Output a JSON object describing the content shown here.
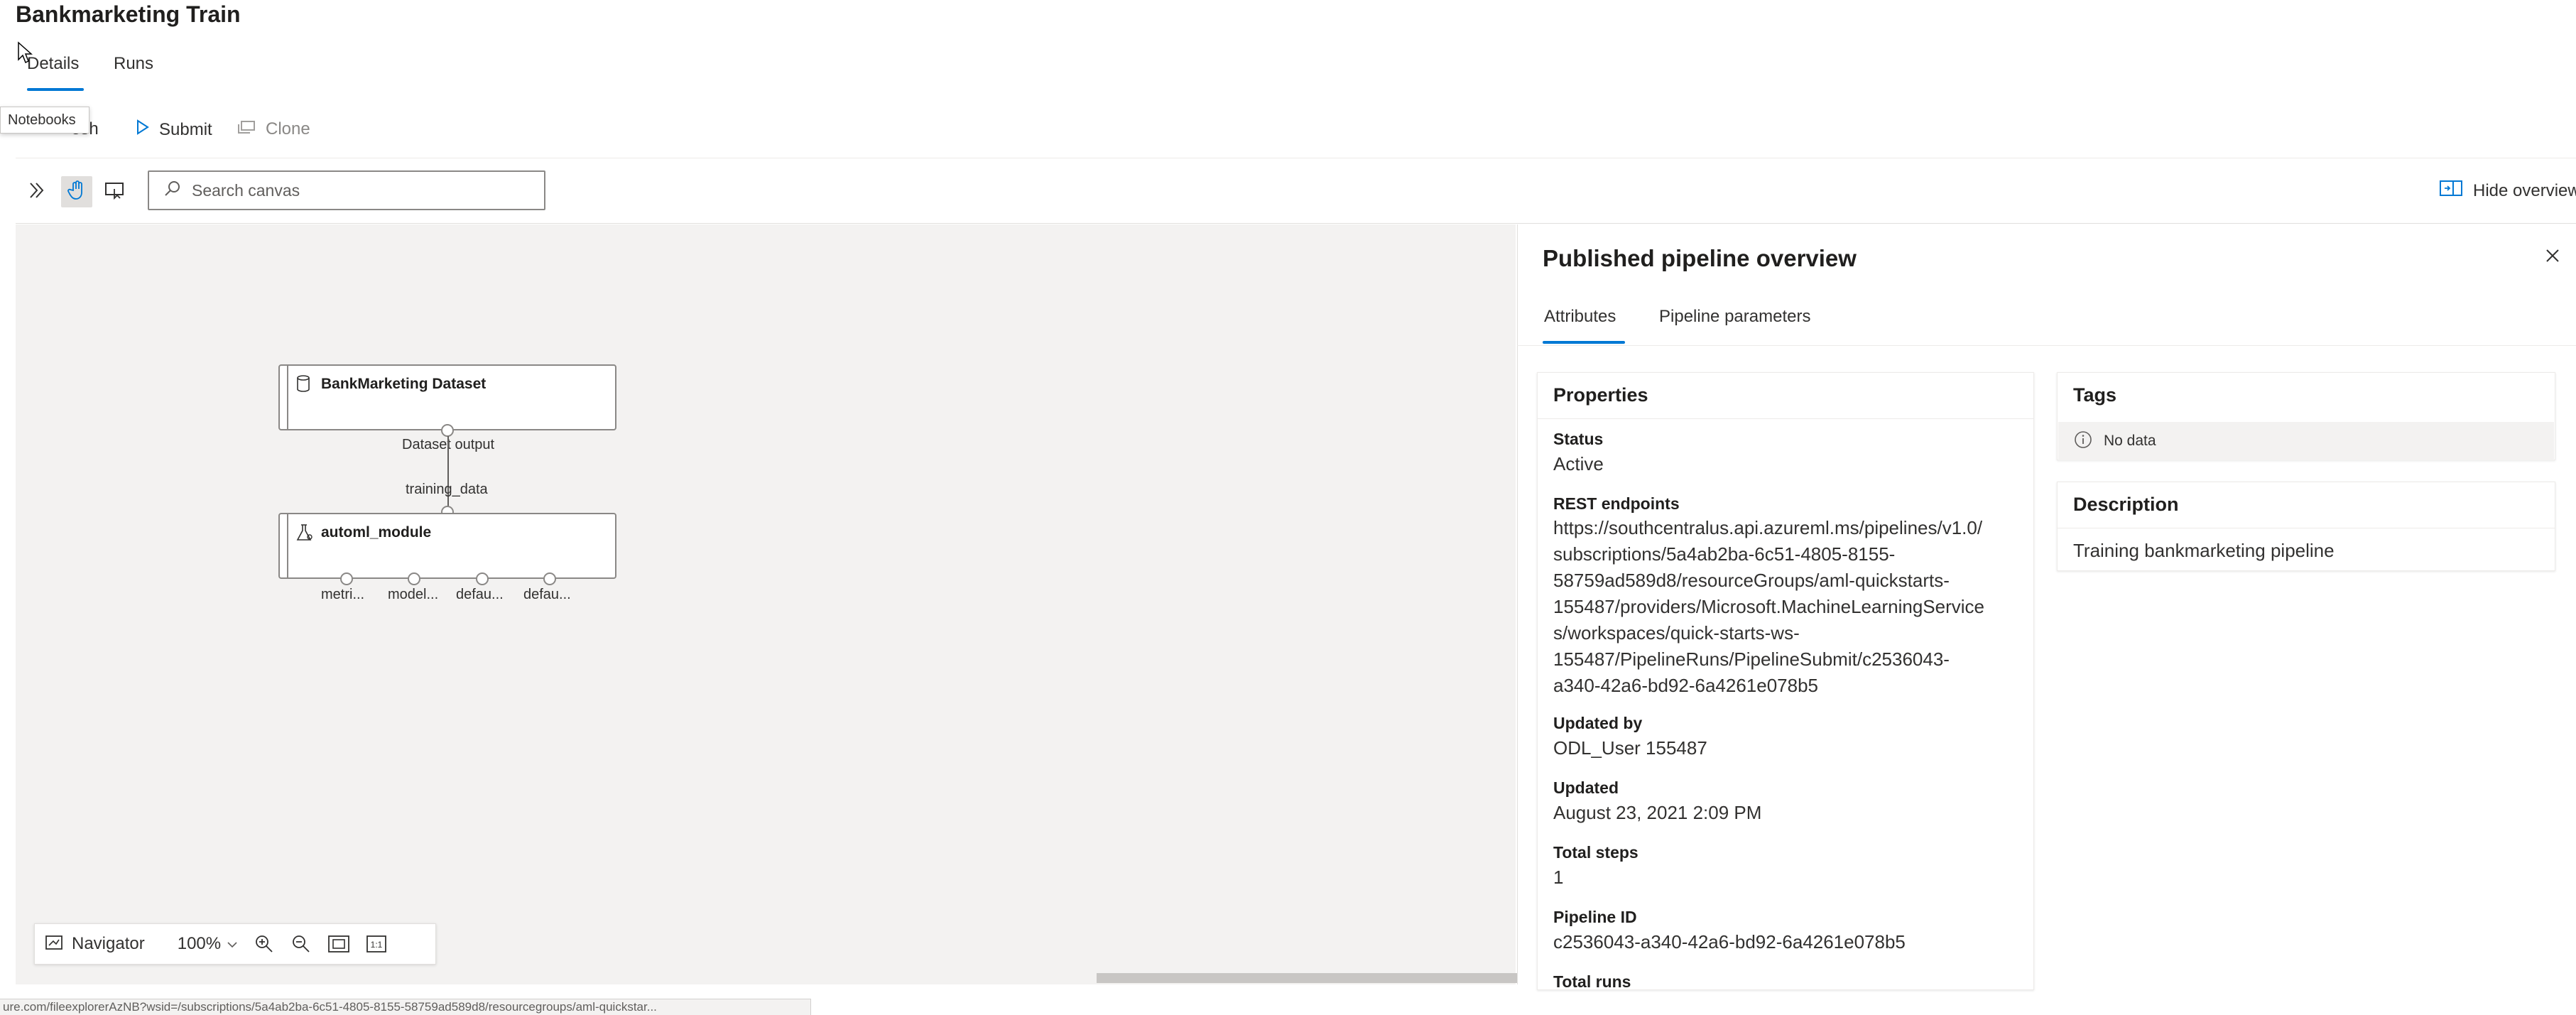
{
  "page": {
    "title": "Bankmarketing Train",
    "tabs": [
      {
        "label": "Details",
        "active": true
      },
      {
        "label": "Runs",
        "active": false
      }
    ]
  },
  "commands": {
    "refresh_visible": "esh",
    "submit": "Submit",
    "clone": "Clone"
  },
  "tooltip": "Notebooks",
  "canvas_toolbar": {
    "search_placeholder": "Search canvas",
    "hide_overview": "Hide overview"
  },
  "pipeline": {
    "dataset_node": {
      "title": "BankMarketing Dataset",
      "output_label": "Dataset output"
    },
    "edge_label": "training_data",
    "automl_node": {
      "title": "automl_module",
      "outputs": [
        "metri...",
        "model...",
        "defau...",
        "defau..."
      ]
    }
  },
  "navigator": {
    "label": "Navigator",
    "zoom": "100%"
  },
  "panel": {
    "title": "Published pipeline overview",
    "tabs": [
      {
        "label": "Attributes",
        "active": true
      },
      {
        "label": "Pipeline parameters",
        "active": false
      }
    ],
    "properties": {
      "title": "Properties",
      "status_label": "Status",
      "status_value": "Active",
      "rest_label": "REST endpoints",
      "rest_lines": [
        "https://southcentralus.api.azureml.ms/pipelines/v1.0/",
        "subscriptions/5a4ab2ba-6c51-4805-8155-",
        "58759ad589d8/resourceGroups/aml-quickstarts-",
        "155487/providers/Microsoft.MachineLearningService",
        "s/workspaces/quick-starts-ws-",
        "155487/PipelineRuns/PipelineSubmit/c2536043-",
        "a340-42a6-bd92-6a4261e078b5"
      ],
      "updated_by_label": "Updated by",
      "updated_by_value": "ODL_User 155487",
      "updated_label": "Updated",
      "updated_value": "August 23, 2021 2:09 PM",
      "total_steps_label": "Total steps",
      "total_steps_value": "1",
      "pipeline_id_label": "Pipeline ID",
      "pipeline_id_value": "c2536043-a340-42a6-bd92-6a4261e078b5",
      "total_runs_label": "Total runs"
    },
    "tags": {
      "title": "Tags",
      "empty": "No data"
    },
    "description": {
      "title": "Description",
      "value": "Training bankmarketing pipeline"
    }
  },
  "status_bar": "ure.com/fileexplorerAzNB?wsid=/subscriptions/5a4ab2ba-6c51-4805-8155-58759ad589d8/resourcegroups/aml-quickstar...",
  "colors": {
    "accent": "#0078d4",
    "canvas_bg": "#f3f2f1",
    "text": "#323130"
  }
}
